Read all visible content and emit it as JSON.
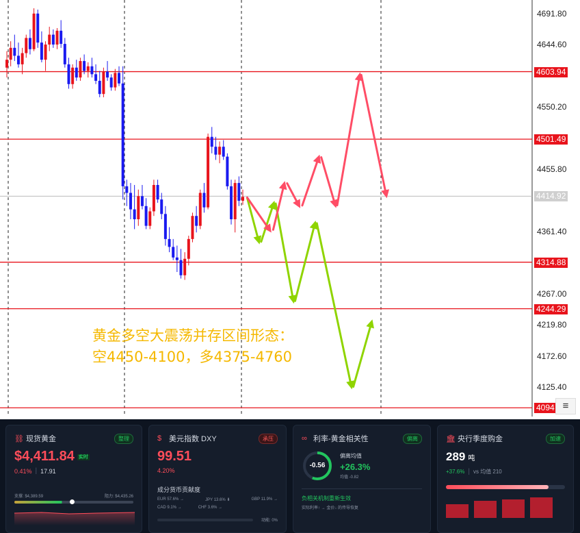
{
  "chart": {
    "annotation_line1": "黄金多空大震荡并存区间形态：",
    "annotation_line2": "空4450-4100，多4375-4760",
    "axis_ticks": [
      "4691.80",
      "4644.60",
      "4550.20",
      "4455.80",
      "4361.40",
      "4267.00",
      "4219.80",
      "4172.60",
      "4125.40"
    ],
    "levels": [
      "4603.94",
      "4501.49",
      "4314.88",
      "4244.29",
      "4094"
    ],
    "current_price": "4414.92",
    "axis_menu_icon": "hamburger-icon",
    "colors": {
      "up": "#e8141c",
      "down": "#1a1af0",
      "level": "#e8141c",
      "bull_arrow": "#ff4d66",
      "bear_arrow": "#8fd400",
      "annotation": "#f5b800"
    }
  },
  "chart_data": {
    "type": "candlestick",
    "ylim": [
      4094,
      4700
    ],
    "candles": [
      [
        4610,
        4635,
        4595,
        4622
      ],
      [
        4622,
        4650,
        4612,
        4640
      ],
      [
        4640,
        4660,
        4620,
        4628
      ],
      [
        4628,
        4648,
        4610,
        4615
      ],
      [
        4615,
        4640,
        4600,
        4632
      ],
      [
        4632,
        4660,
        4625,
        4655
      ],
      [
        4655,
        4668,
        4630,
        4638
      ],
      [
        4638,
        4700,
        4635,
        4692
      ],
      [
        4692,
        4698,
        4640,
        4648
      ],
      [
        4648,
        4665,
        4618,
        4622
      ],
      [
        4622,
        4650,
        4605,
        4645
      ],
      [
        4645,
        4672,
        4635,
        4660
      ],
      [
        4660,
        4668,
        4640,
        4645
      ],
      [
        4645,
        4670,
        4638,
        4666
      ],
      [
        4666,
        4682,
        4640,
        4646
      ],
      [
        4646,
        4655,
        4610,
        4615
      ],
      [
        4615,
        4625,
        4578,
        4585
      ],
      [
        4585,
        4615,
        4578,
        4610
      ],
      [
        4610,
        4622,
        4590,
        4595
      ],
      [
        4595,
        4625,
        4590,
        4620
      ],
      [
        4620,
        4630,
        4600,
        4605
      ],
      [
        4605,
        4618,
        4595,
        4612
      ],
      [
        4612,
        4625,
        4595,
        4600
      ],
      [
        4600,
        4615,
        4585,
        4590
      ],
      [
        4590,
        4605,
        4565,
        4570
      ],
      [
        4570,
        4610,
        4565,
        4604
      ],
      [
        4604,
        4620,
        4590,
        4595
      ],
      [
        4595,
        4600,
        4575,
        4580
      ],
      [
        4580,
        4608,
        4575,
        4602
      ],
      [
        4602,
        4612,
        4582,
        4586
      ],
      [
        4586,
        4612,
        4410,
        4430
      ],
      [
        4430,
        4440,
        4400,
        4420
      ],
      [
        4420,
        4435,
        4380,
        4395
      ],
      [
        4395,
        4432,
        4365,
        4380
      ],
      [
        4380,
        4425,
        4370,
        4415
      ],
      [
        4415,
        4432,
        4395,
        4400
      ],
      [
        4400,
        4412,
        4365,
        4370
      ],
      [
        4370,
        4398,
        4365,
        4392
      ],
      [
        4392,
        4440,
        4385,
        4432
      ],
      [
        4432,
        4440,
        4405,
        4410
      ],
      [
        4410,
        4420,
        4380,
        4388
      ],
      [
        4388,
        4400,
        4340,
        4350
      ],
      [
        4350,
        4368,
        4330,
        4338
      ],
      [
        4338,
        4350,
        4318,
        4322
      ],
      [
        4322,
        4340,
        4300,
        4318
      ],
      [
        4318,
        4335,
        4290,
        4295
      ],
      [
        4295,
        4330,
        4288,
        4320
      ],
      [
        4320,
        4355,
        4310,
        4350
      ],
      [
        4350,
        4390,
        4345,
        4385
      ],
      [
        4385,
        4400,
        4360,
        4370
      ],
      [
        4370,
        4425,
        4365,
        4420
      ],
      [
        4420,
        4435,
        4390,
        4398
      ],
      [
        4398,
        4510,
        4395,
        4505
      ],
      [
        4505,
        4520,
        4480,
        4490
      ],
      [
        4490,
        4505,
        4470,
        4478
      ],
      [
        4478,
        4498,
        4465,
        4490
      ],
      [
        4490,
        4500,
        4470,
        4475
      ],
      [
        4475,
        4480,
        4425,
        4430
      ],
      [
        4430,
        4440,
        4372,
        4380
      ],
      [
        4380,
        4440,
        4360,
        4435
      ],
      [
        4435,
        4445,
        4400,
        4408
      ],
      [
        4408,
        4425,
        4402,
        4414
      ]
    ],
    "forecast_bull_path": [
      4418,
      4358,
      4440,
      4395,
      4480,
      4395,
      4605,
      4410
    ],
    "forecast_bear_path": [
      4418,
      4340,
      4410,
      4250,
      4380,
      4120,
      4230
    ]
  },
  "dashboard": {
    "gold": {
      "icon": "link-icon",
      "title": "现货黄金",
      "badge": "整理",
      "price": "$4,411.84",
      "realtime": "实时",
      "change_pct": "0.41%",
      "change_abs": "17.91",
      "support": "支撑: $4,389.59",
      "resistance": "阻力: $4,435.26",
      "range_fraction": 0.48
    },
    "dxy": {
      "icon": "dollar-icon",
      "title": "美元指数 DXY",
      "badge": "承压",
      "value": "99.51",
      "change": "4.20%",
      "sub_title": "成分货币贡献度",
      "fx": [
        {
          "name": "EUR 57.6% →"
        },
        {
          "name": "JPY 13.6% ⬇"
        },
        {
          "name": "GBP 11.9% →"
        },
        {
          "name": "CAD 9.1% →"
        },
        {
          "name": "CHF 3.6% →"
        }
      ],
      "momentum": "动能: 0%"
    },
    "corr": {
      "icon": "chain-icon",
      "title": "利率-黄金相关性",
      "badge": "偏离",
      "gauge": "-0.56",
      "label": "偏离均值",
      "value": "+26.3%",
      "mean": "均值 -0.82",
      "msg": "负相关机制重新生效",
      "sub": "实际利率↑ → 金价↓ 的传导恢复"
    },
    "cb": {
      "icon": "bank-icon",
      "title": "央行季度购金",
      "badge": "加速",
      "value": "289",
      "unit": "吨",
      "delta": "+37.6%",
      "vs": "vs 均值 210",
      "bar_fraction": 0.86
    }
  }
}
